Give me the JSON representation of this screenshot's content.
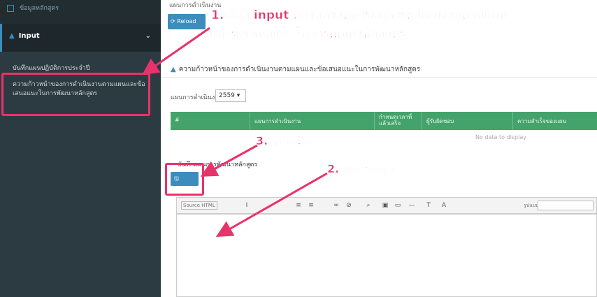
{
  "sidebar": {
    "top_item": "ข้อมูลหลักสูตร",
    "input_label": "Input",
    "items": [
      {
        "label": "บันทึกแผนปฏิบัติการประจำปี"
      },
      {
        "label": "ความก้าวหน้าของการดำเนินงานตามแผนและข้อเสนอแนะในการพัฒนาหลักสูตร"
      }
    ]
  },
  "main": {
    "header_text": "แผนการดำเนินงาน",
    "reload_label": "Reload",
    "section_title": "ความก้าวหน้าของการดำเนินงานตามแผนและข้อเสนอแนะในการพัฒนาหลักสูตร",
    "year_label": "แผนการดำเนินงานปี",
    "year_value": "2559",
    "grid_headers": [
      "#",
      "แผนการดำเนินงาน",
      "กำหนดเวลาที่แล้วเสร็จ",
      "ผู้รับผิดชอบ",
      "ความสำเร็จของแผน"
    ],
    "no_data": "No data to display",
    "plan_label": "บันทึกแผนการพัฒนาหลักสูตร",
    "save_label": "บันทึก",
    "editor": {
      "source_label": "Source HTML",
      "format_label": "รูปแบบ"
    }
  },
  "annotations": {
    "step1_line1": "1.เลือก input ความก้าวหน้าของการดำเนินงานตามแผน",
    "step1_line2": "และข้อเสนอแนะในการพัฒนาหลักสูตร",
    "step2": "2.กรอกข้อมูล",
    "step3": "3.กดบันทึก"
  },
  "colors": {
    "sidebar_bg": "#222d32",
    "accent": "#3c8dbc",
    "grid_header": "#44a36a",
    "annotation": "#e8326b"
  }
}
